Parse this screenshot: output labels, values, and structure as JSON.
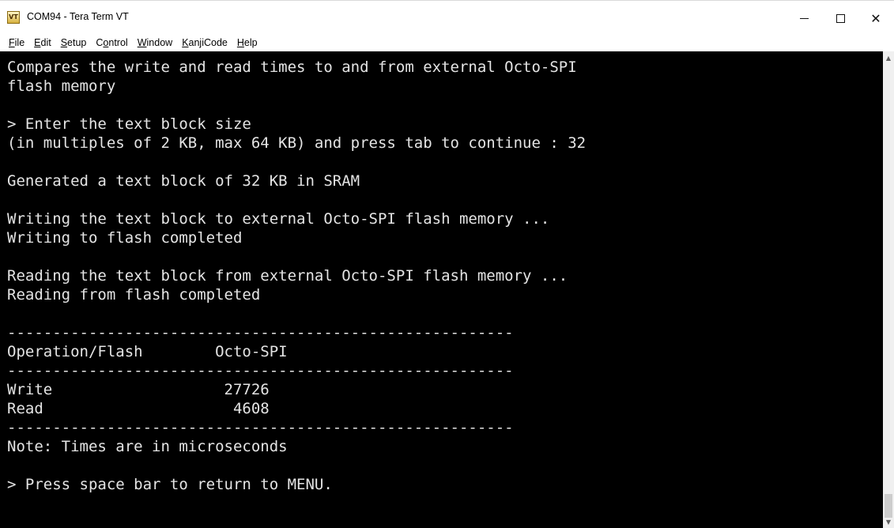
{
  "window": {
    "title": "COM94 - Tera Term VT",
    "icon_text": "VT",
    "controls": {
      "minimize": "minimize-icon",
      "maximize": "maximize-icon",
      "close": "✕"
    }
  },
  "menu": {
    "items": [
      {
        "pre": "",
        "key": "F",
        "post": "ile"
      },
      {
        "pre": "",
        "key": "E",
        "post": "dit"
      },
      {
        "pre": "",
        "key": "S",
        "post": "etup"
      },
      {
        "pre": "C",
        "key": "o",
        "post": "ntrol"
      },
      {
        "pre": "",
        "key": "W",
        "post": "indow"
      },
      {
        "pre": "",
        "key": "K",
        "post": "anjiCode"
      },
      {
        "pre": "",
        "key": "H",
        "post": "elp"
      }
    ]
  },
  "terminal": {
    "lines": [
      "Compares the write and read times to and from external Octo-SPI",
      "flash memory",
      "",
      "> Enter the text block size",
      "(in multiples of 2 KB, max 64 KB) and press tab to continue : 32",
      "",
      "Generated a text block of 32 KB in SRAM",
      "",
      "Writing the text block to external Octo-SPI flash memory ...",
      "Writing to flash completed",
      "",
      "Reading the text block from external Octo-SPI flash memory ...",
      "Reading from flash completed",
      "",
      "--------------------------------------------------------",
      "Operation/Flash        Octo-SPI",
      "--------------------------------------------------------",
      "Write                   27726",
      "Read                     4608",
      "--------------------------------------------------------",
      "Note: Times are in microseconds",
      "",
      "> Press space bar to return to MENU."
    ]
  },
  "scrollbar": {
    "up_arrow": "▲",
    "down_arrow": "▼"
  },
  "colors": {
    "terminal_bg": "#000000",
    "terminal_fg": "#e4e4e4",
    "chrome_bg": "#ffffff"
  }
}
